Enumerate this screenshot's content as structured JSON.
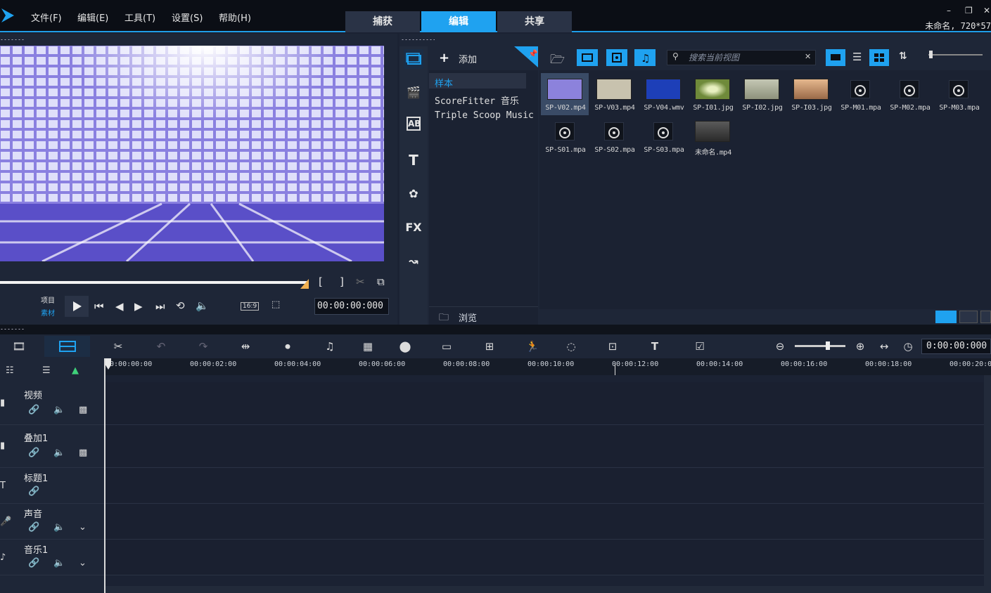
{
  "menubar": {
    "items": [
      "文件(F)",
      "编辑(E)",
      "工具(T)",
      "设置(S)",
      "帮助(H)"
    ]
  },
  "tabs": [
    {
      "label": "捕获",
      "active": false
    },
    {
      "label": "编辑",
      "active": true
    },
    {
      "label": "共享",
      "active": false
    }
  ],
  "window_controls": {
    "minimize": "–",
    "restore": "❐",
    "close": "✕"
  },
  "project_info": "未命名, 720*57",
  "preview": {
    "mode_project": "项目",
    "mode_clip": "素材",
    "timecode": "00:00:00:000",
    "aspect": "16:9"
  },
  "library": {
    "add_label": "添加",
    "folders": [
      "样本",
      "ScoreFitter 音乐",
      "Triple Scoop Music"
    ],
    "browse_label": "浏览",
    "search_placeholder": "搜索当前视图",
    "side_icons": [
      "media-icon",
      "instant-project-icon",
      "transition-icon",
      "title-icon",
      "graphic-icon",
      "filter-icon",
      "motion-path-icon"
    ],
    "side_labels": [
      "",
      "",
      "AB",
      "T",
      "",
      "FX",
      ""
    ],
    "items": [
      {
        "name": "SP-V02.mp4",
        "kind": "video",
        "color": "#8c82dc",
        "selected": true
      },
      {
        "name": "SP-V03.mp4",
        "kind": "video",
        "color": "#c8c2ae",
        "selected": false
      },
      {
        "name": "SP-V04.wmv",
        "kind": "video",
        "color": "#1d3fb8",
        "selected": false
      },
      {
        "name": "SP-I01.jpg",
        "kind": "image",
        "color": "#6f8a3a",
        "selected": false
      },
      {
        "name": "SP-I02.jpg",
        "kind": "image",
        "color": "#a7ab97",
        "selected": false
      },
      {
        "name": "SP-I03.jpg",
        "kind": "image",
        "color": "#c08a60",
        "selected": false
      },
      {
        "name": "SP-M01.mpa",
        "kind": "music",
        "color": "#10141c",
        "selected": false
      },
      {
        "name": "SP-M02.mpa",
        "kind": "music",
        "color": "#10141c",
        "selected": false
      },
      {
        "name": "SP-M03.mpa",
        "kind": "music",
        "color": "#10141c",
        "selected": false
      },
      {
        "name": "SP-S01.mpa",
        "kind": "music",
        "color": "#10141c",
        "selected": false
      },
      {
        "name": "SP-S02.mpa",
        "kind": "music",
        "color": "#10141c",
        "selected": false
      },
      {
        "name": "SP-S03.mpa",
        "kind": "music",
        "color": "#10141c",
        "selected": false
      },
      {
        "name": "未命名.mp4",
        "kind": "video",
        "color": "#5a5a5a",
        "selected": false
      }
    ]
  },
  "timeline": {
    "timecode": "0:00:00:000",
    "ruler": [
      "00:00:00:00",
      "00:00:02:00",
      "00:00:04:00",
      "00:00:06:00",
      "00:00:08:00",
      "00:00:10:00",
      "00:00:12:00",
      "00:00:14:00",
      "00:00:16:00",
      "00:00:18:00",
      "00:00:20:0"
    ],
    "tracks": [
      {
        "name": "视频",
        "icon": "video-track-icon"
      },
      {
        "name": "叠加1",
        "icon": "overlay-track-icon"
      },
      {
        "name": "标题1",
        "icon": "title-track-icon"
      },
      {
        "name": "声音",
        "icon": "voice-track-icon"
      },
      {
        "name": "音乐1",
        "icon": "music-track-icon"
      }
    ]
  },
  "colors": {
    "accent": "#1fa2f0",
    "background": "#1b2233",
    "panel": "#1e2637"
  }
}
